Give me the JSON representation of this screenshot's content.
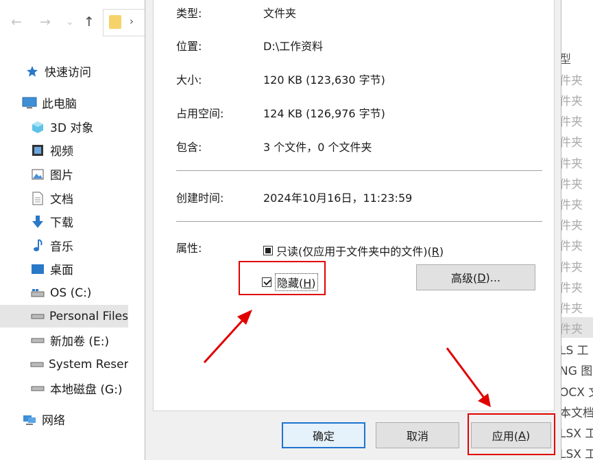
{
  "explorer": {
    "nav_buttons": {
      "back": "←",
      "forward": "→",
      "recent": "⌄",
      "up": "↑"
    },
    "breadcrumb_chevron": "›",
    "nav_items": [
      {
        "label": "快速访问",
        "icon": "star-icon"
      },
      {
        "label": "此电脑",
        "icon": "computer-icon"
      },
      {
        "label": "3D 对象",
        "icon": "cube-icon"
      },
      {
        "label": "视频",
        "icon": "video-icon"
      },
      {
        "label": "图片",
        "icon": "picture-icon"
      },
      {
        "label": "文档",
        "icon": "document-icon"
      },
      {
        "label": "下载",
        "icon": "download-icon"
      },
      {
        "label": "音乐",
        "icon": "music-icon"
      },
      {
        "label": "桌面",
        "icon": "desktop-icon"
      },
      {
        "label": "OS (C:)",
        "icon": "drive-icon"
      },
      {
        "label": "Personal Files",
        "icon": "drive-icon",
        "selected": true
      },
      {
        "label": "新加卷 (E:)",
        "icon": "drive-icon"
      },
      {
        "label": "System Reser",
        "icon": "drive-icon"
      },
      {
        "label": "本地磁盘 (G:)",
        "icon": "drive-icon"
      },
      {
        "label": "网络",
        "icon": "network-icon"
      }
    ],
    "right_column": {
      "header": "型",
      "rows": [
        "件夹",
        "件夹",
        "件夹",
        "件夹",
        "件夹",
        "件夹",
        "件夹",
        "件夹",
        "件夹",
        "件夹",
        "件夹",
        "件夹",
        "件夹",
        "LS 工",
        "NG 图",
        "OCX 文",
        "本文档",
        "LSX 工",
        "LSX 工"
      ]
    }
  },
  "dialog": {
    "type_label": "类型:",
    "type_value": "文件夹",
    "location_label": "位置:",
    "location_value": "D:\\工作资料",
    "size_label": "大小:",
    "size_value": "120 KB (123,630 字节)",
    "size_on_disk_label": "占用空间:",
    "size_on_disk_value": "124 KB (126,976 字节)",
    "contains_label": "包含:",
    "contains_value": "3 个文件，0 个文件夹",
    "created_label": "创建时间:",
    "created_value": "2024年10月16日，11:23:59",
    "attributes_label": "属性:",
    "readonly_label_pre": "只读(仅应用于文件夹中的文件)(",
    "readonly_accel": "R",
    "readonly_label_post": ")",
    "hidden_label_pre": "隐藏(",
    "hidden_accel": "H",
    "hidden_label_post": ")",
    "hidden_checked": true,
    "advanced_pre": "高级(",
    "advanced_accel": "D",
    "advanced_post": ")...",
    "ok_label": "确定",
    "cancel_label": "取消",
    "apply_pre": "应用(",
    "apply_accel": "A",
    "apply_post": ")"
  },
  "colors": {
    "highlight": "#e00000",
    "default_button_border": "#1e73d0"
  }
}
